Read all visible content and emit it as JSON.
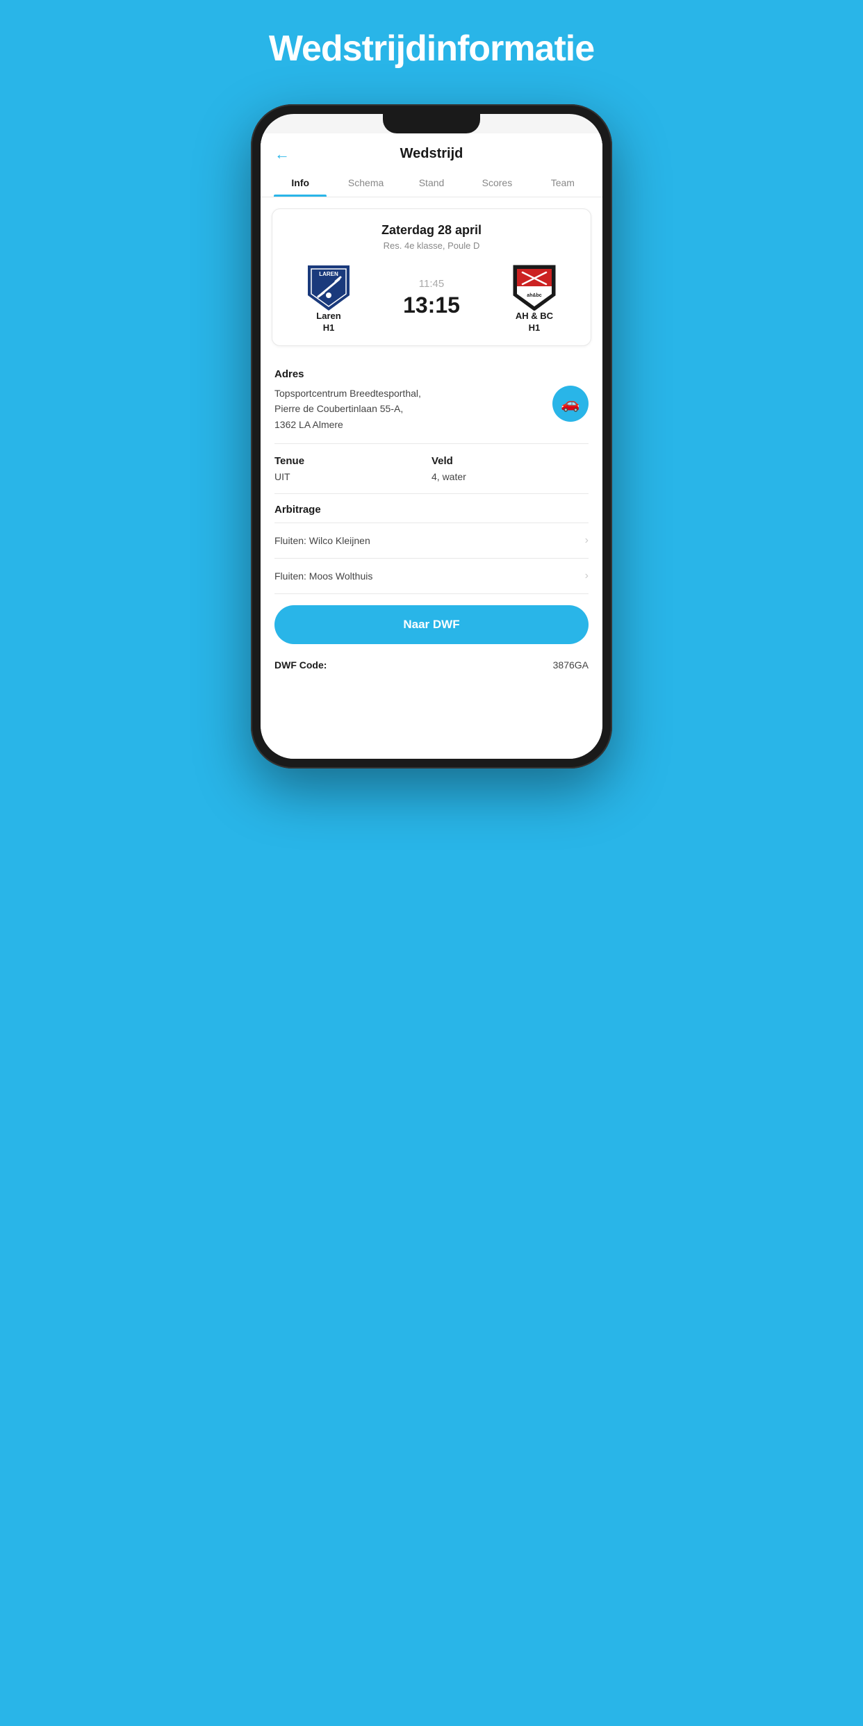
{
  "page": {
    "title": "Wedstrijdinformatie"
  },
  "header": {
    "back_label": "←",
    "title": "Wedstrijd"
  },
  "tabs": [
    {
      "label": "Info",
      "active": true
    },
    {
      "label": "Schema",
      "active": false
    },
    {
      "label": "Stand",
      "active": false
    },
    {
      "label": "Scores",
      "active": false
    },
    {
      "label": "Team",
      "active": false
    }
  ],
  "match": {
    "date": "Zaterdag 28 april",
    "league": "Res. 4e klasse, Poule D",
    "home_team": "Laren",
    "home_sub": "H1",
    "score_time": "11:45",
    "score_main": "13:15",
    "away_team": "AH & BC",
    "away_sub": "H1"
  },
  "address": {
    "label": "Adres",
    "text_line1": "Topsportcentrum Breedtesporthal,",
    "text_line2": "Pierre de Coubertinlaan 55-A,",
    "text_line3": "1362 LA Almere"
  },
  "tenue": {
    "label": "Tenue",
    "value": "UIT"
  },
  "veld": {
    "label": "Veld",
    "value": "4, water"
  },
  "arbitrage": {
    "label": "Arbitrage",
    "items": [
      {
        "text": "Fluiten: Wilco Kleijnen"
      },
      {
        "text": "Fluiten: Moos Wolthuis"
      }
    ]
  },
  "dwf_button": {
    "label": "Naar DWF"
  },
  "dwf_code": {
    "label": "DWF Code:",
    "value": "3876GA"
  },
  "colors": {
    "primary": "#29b5e8",
    "background": "#29b5e8"
  }
}
